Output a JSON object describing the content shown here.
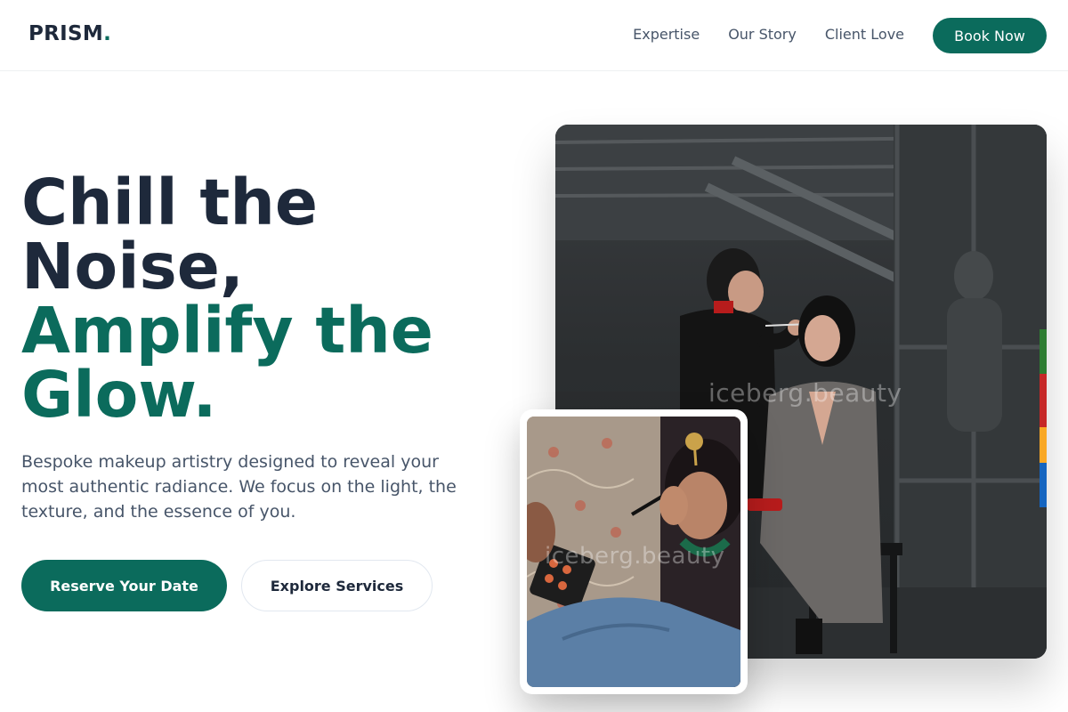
{
  "nav": {
    "logo_text": "PRISM",
    "logo_dot": ".",
    "links": [
      "Expertise",
      "Our Story",
      "Client Love"
    ],
    "cta_label": "Book Now"
  },
  "hero": {
    "headline_line1": "Chill the",
    "headline_line2": "Noise,",
    "headline_line3": "Amplify the",
    "headline_line4": "Glow.",
    "lead": "Bespoke makeup artistry designed to reveal your most authentic radiance. We focus on the light, the texture, and the essence of you.",
    "primary_cta": "Reserve Your Date",
    "secondary_cta": "Explore Services"
  },
  "images": {
    "main_watermark": "iceberg.beauty",
    "inset_watermark": "iceberg.beauty"
  },
  "colors": {
    "accent": "#0b6b5c",
    "heading": "#1e293b",
    "body": "#475569"
  }
}
